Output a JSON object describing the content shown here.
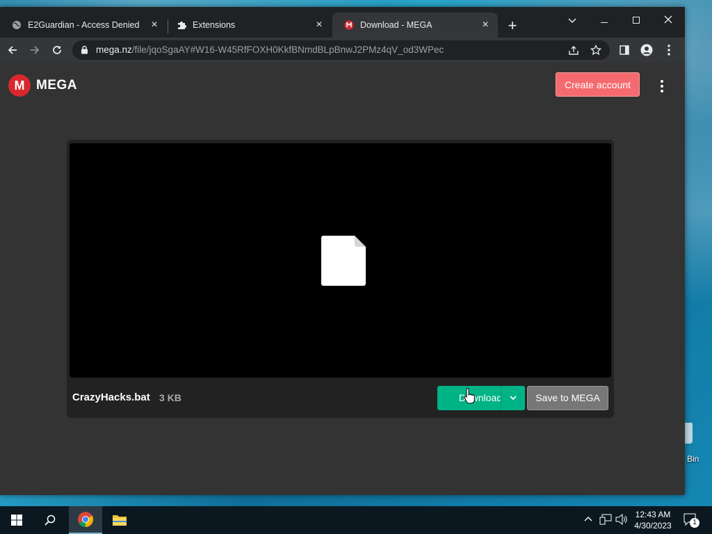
{
  "browser": {
    "tabs": [
      {
        "label": "E2Guardian - Access Denied",
        "icon": "globe-icon"
      },
      {
        "label": "Extensions",
        "icon": "puzzle-icon"
      },
      {
        "label": "Download - MEGA",
        "icon": "mega-icon"
      }
    ],
    "url_host": "mega.nz",
    "url_path": "/file/jqoSgaAY#W16-W45RfFOXH0KkfBNmdBLpBnwJ2PMz4qV_od3WPec"
  },
  "mega": {
    "logo_letter": "M",
    "logo_text": "MEGA",
    "create_account": "Create account",
    "file_name": "CrazyHacks.bat",
    "file_size": "3 KB",
    "download_label": "Download",
    "save_label": "Save to MEGA",
    "accent": "#00b386",
    "brand_red": "#d9272e"
  },
  "desktop": {
    "recycle_label": "Bin"
  },
  "taskbar": {
    "time": "12:43 AM",
    "date": "4/30/2023",
    "notification_count": "1"
  }
}
